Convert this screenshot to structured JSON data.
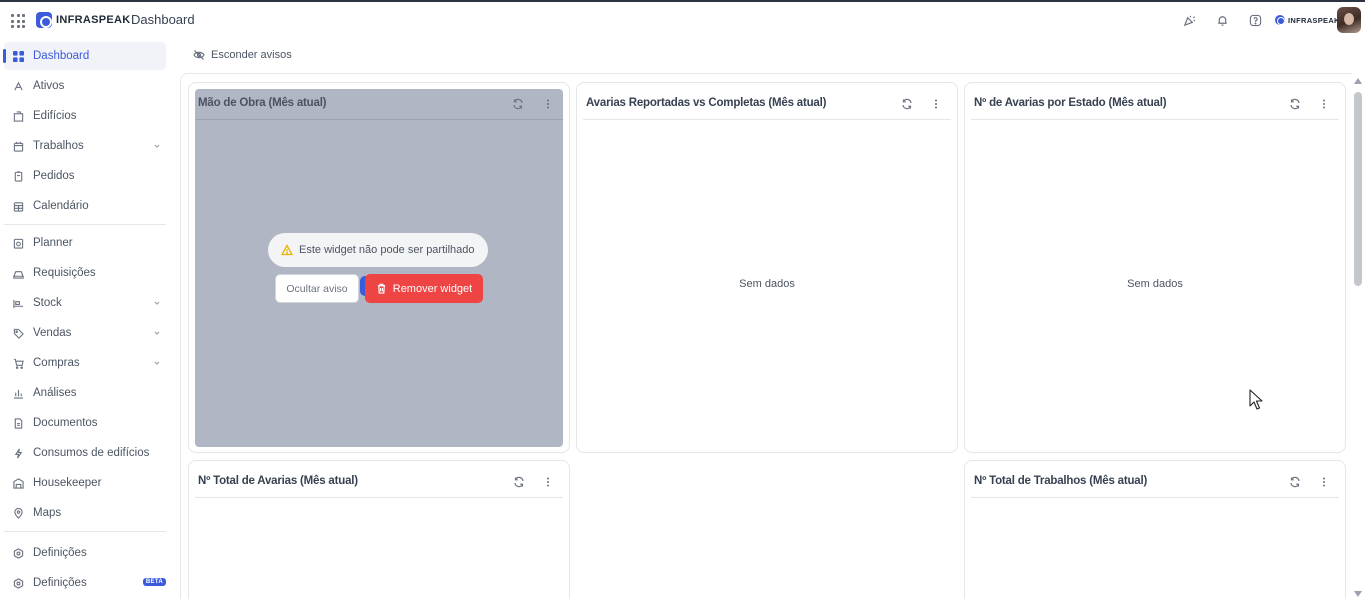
{
  "header": {
    "brand": "INFRASPEAK",
    "page_title": "Dashboard",
    "small_brand": "INFRASPEAK",
    "icons": [
      "apps-grid-icon",
      "celebration-icon",
      "bell-icon",
      "help-icon"
    ]
  },
  "sidebar": {
    "items": [
      {
        "label": "Dashboard",
        "icon": "grid-icon",
        "active": true
      },
      {
        "label": "Ativos",
        "icon": "asset-icon"
      },
      {
        "label": "Edifícios",
        "icon": "building-icon"
      },
      {
        "label": "Trabalhos",
        "icon": "calendar-icon",
        "expandable": true
      },
      {
        "label": "Pedidos",
        "icon": "clipboard-icon"
      },
      {
        "label": "Calendário",
        "icon": "calendar-grid-icon"
      },
      {
        "label": "Planner",
        "icon": "planner-icon"
      },
      {
        "label": "Requisições",
        "icon": "tray-icon"
      },
      {
        "label": "Stock",
        "icon": "stock-icon",
        "expandable": true
      },
      {
        "label": "Vendas",
        "icon": "tag-icon",
        "expandable": true
      },
      {
        "label": "Compras",
        "icon": "cart-icon",
        "expandable": true
      },
      {
        "label": "Análises",
        "icon": "bar-chart-icon"
      },
      {
        "label": "Documentos",
        "icon": "document-icon"
      },
      {
        "label": "Consumos de edifícios",
        "icon": "bolt-icon"
      },
      {
        "label": "Housekeeper",
        "icon": "bed-icon"
      },
      {
        "label": "Maps",
        "icon": "map-pin-icon"
      },
      {
        "label": "Definições",
        "icon": "settings-icon"
      },
      {
        "label": "Definições",
        "icon": "settings-icon",
        "badge": "BETA"
      }
    ]
  },
  "toolbar": {
    "hide_warnings": "Esconder avisos"
  },
  "widgets": [
    {
      "title": "Mão de Obra (Mês atual)"
    },
    {
      "title": "Avarias Reportadas vs Completas (Mês atual)",
      "empty_text": "Sem dados"
    },
    {
      "title": "Nº de Avarias por Estado (Mês atual)",
      "empty_text": "Sem dados"
    },
    {
      "title": "Nº Total de Avarias (Mês atual)"
    },
    {
      "title": "Nº Total de Trabalhos (Mês atual)"
    }
  ],
  "overlay": {
    "warning": "Este widget não pode ser partilhado",
    "hide_button": "Ocultar aviso",
    "remove_button": "Remover widget"
  },
  "colors": {
    "accent": "#3b5bdb",
    "danger": "#ef4444",
    "warning": "#eab308",
    "overlay": "#b1b6c4"
  }
}
